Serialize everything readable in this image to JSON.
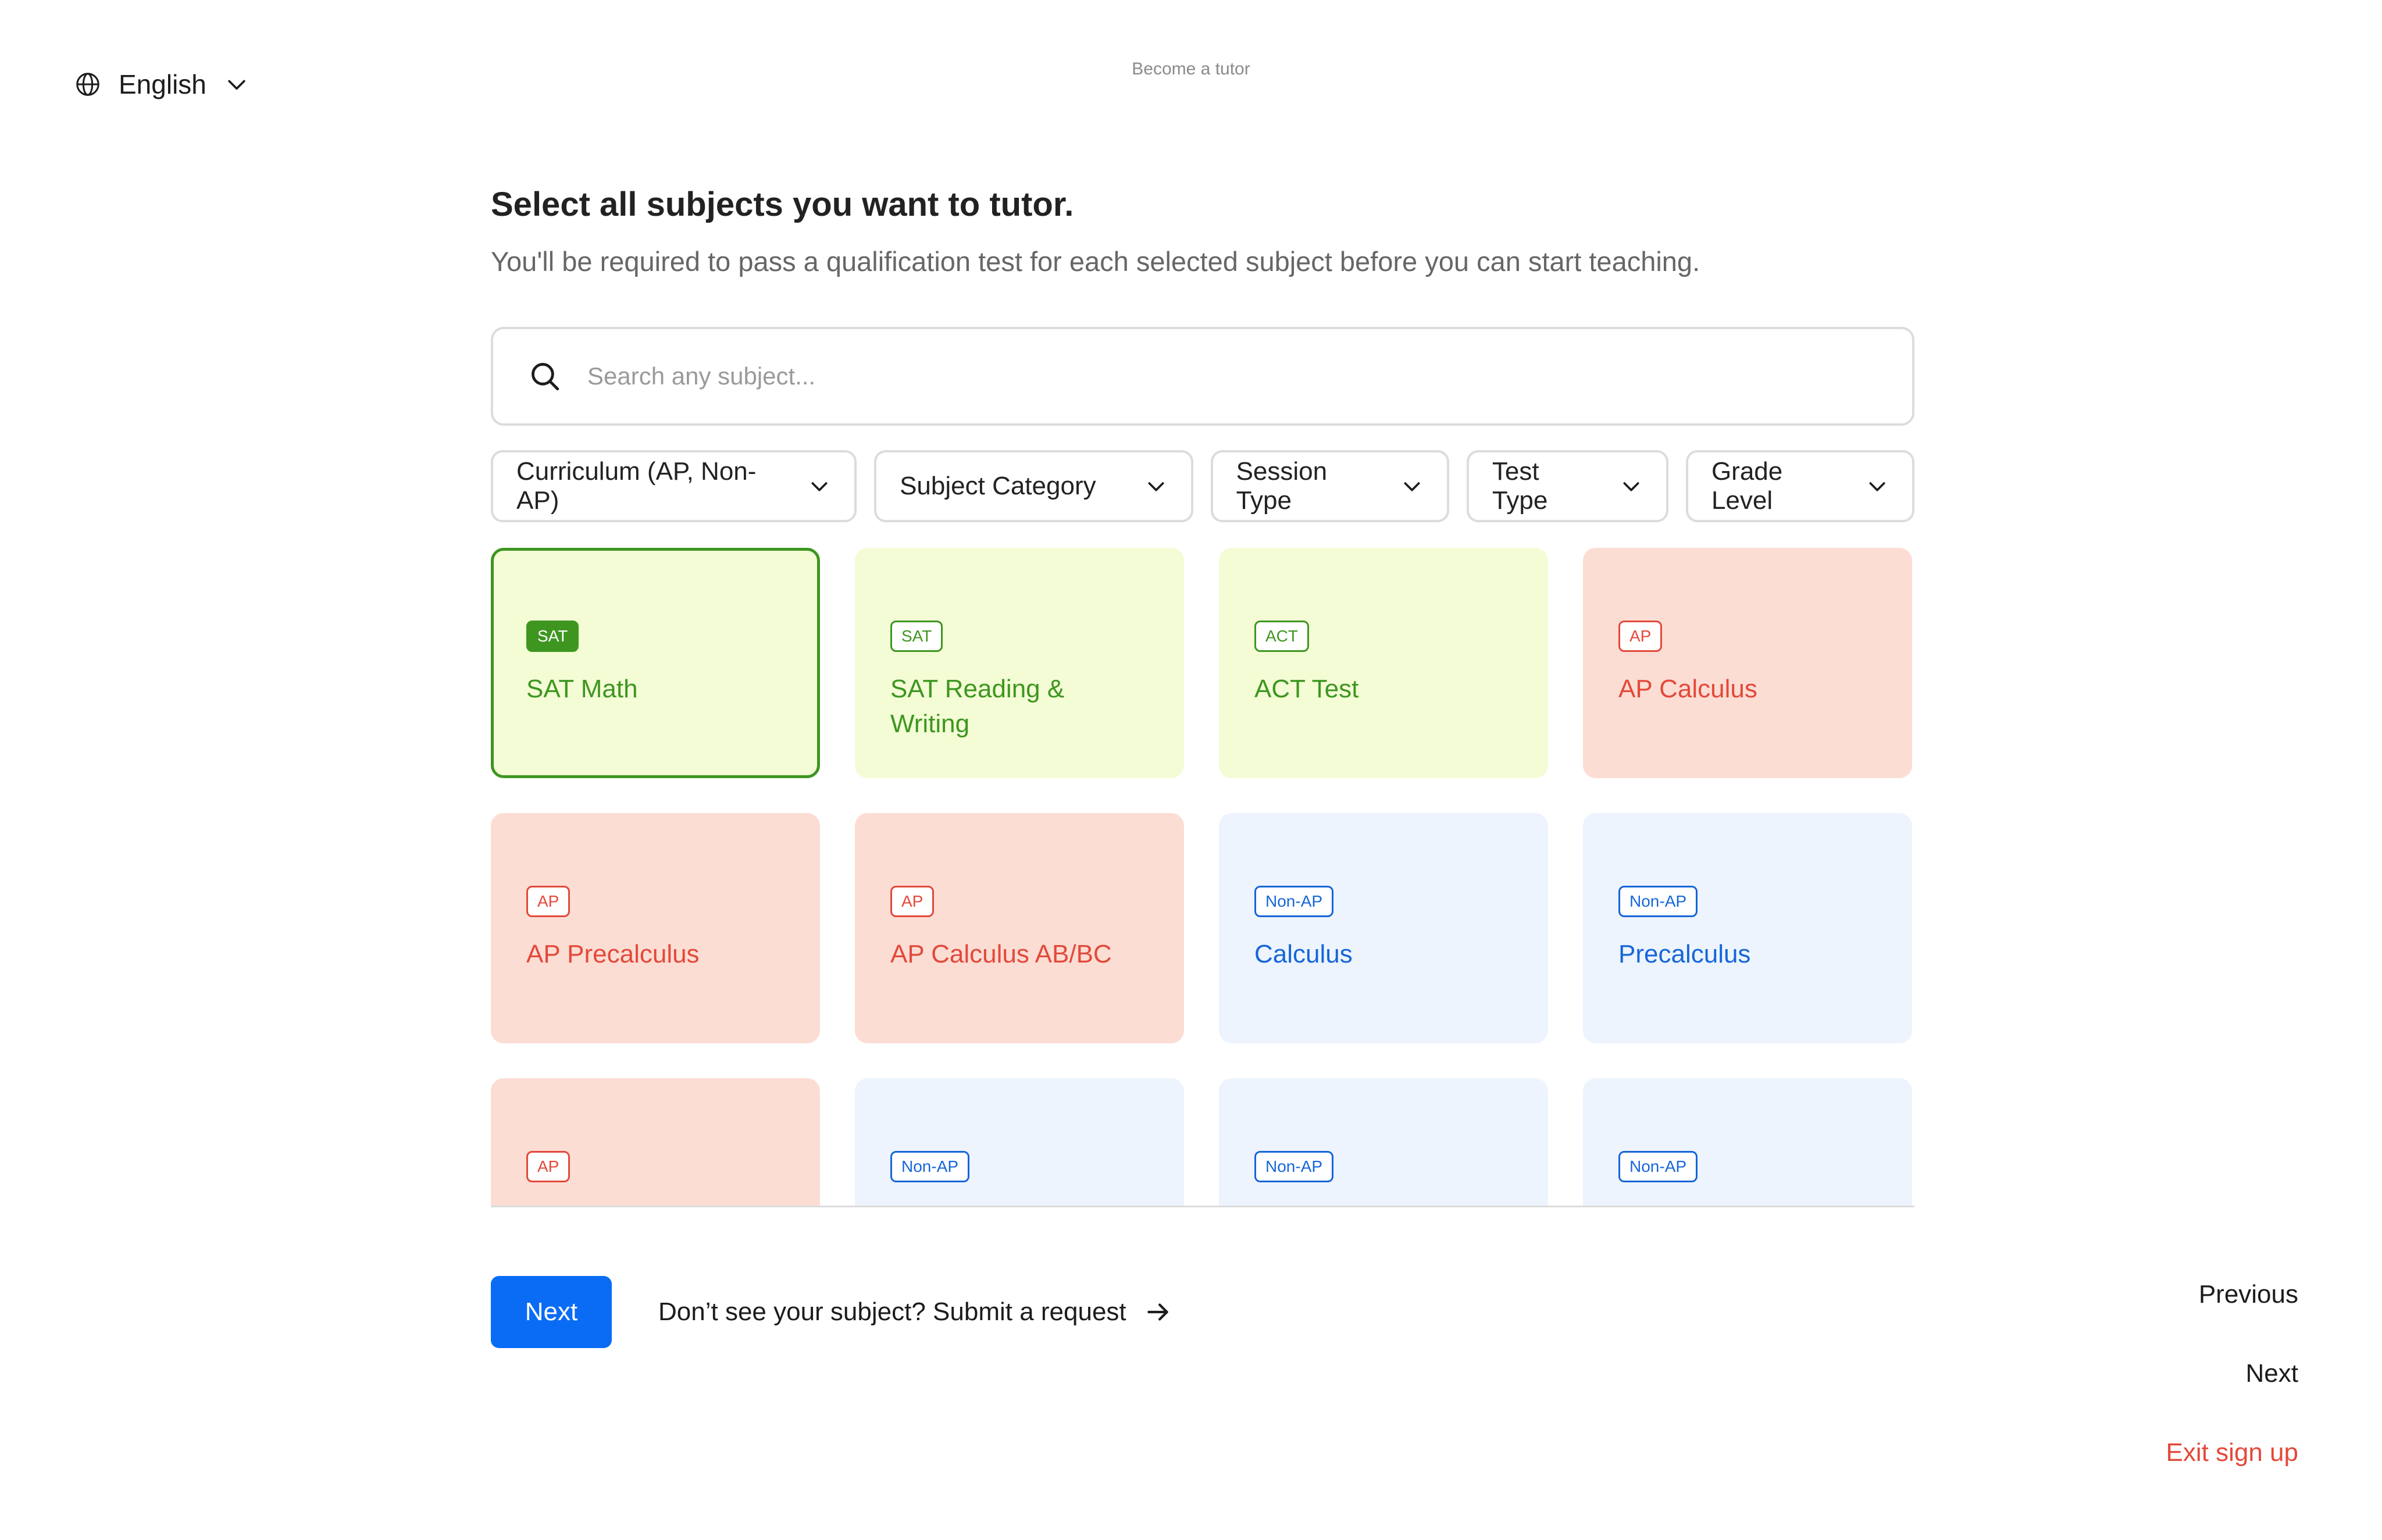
{
  "language": {
    "label": "English",
    "icon": "globe-icon"
  },
  "header": {
    "title": "Become a tutor"
  },
  "heading": "Select all subjects you want to tutor.",
  "subheading": "You'll be required to pass a qualification test for each selected subject before you can start teaching.",
  "search": {
    "placeholder": "Search any subject...",
    "value": ""
  },
  "filters": [
    {
      "label": "Curriculum (AP, Non-AP)"
    },
    {
      "label": "Subject Category"
    },
    {
      "label": "Session Type"
    },
    {
      "label": "Test Type"
    },
    {
      "label": "Grade Level"
    }
  ],
  "cards": [
    {
      "badge": "SAT",
      "title": "SAT Math",
      "color": "green",
      "selected": true
    },
    {
      "badge": "SAT",
      "title": "SAT Reading & Writing",
      "color": "green",
      "selected": false
    },
    {
      "badge": "ACT",
      "title": "ACT Test",
      "color": "green",
      "selected": false
    },
    {
      "badge": "AP",
      "title": "AP Calculus",
      "color": "red",
      "selected": false
    },
    {
      "badge": "AP",
      "title": "AP Precalculus",
      "color": "red",
      "selected": false
    },
    {
      "badge": "AP",
      "title": "AP Calculus AB/BC",
      "color": "red",
      "selected": false
    },
    {
      "badge": "Non-AP",
      "title": "Calculus",
      "color": "blue",
      "selected": false
    },
    {
      "badge": "Non-AP",
      "title": "Precalculus",
      "color": "blue",
      "selected": false
    },
    {
      "badge": "AP",
      "title": "",
      "color": "red",
      "selected": false
    },
    {
      "badge": "Non-AP",
      "title": "",
      "color": "blue",
      "selected": false
    },
    {
      "badge": "Non-AP",
      "title": "",
      "color": "blue",
      "selected": false
    },
    {
      "badge": "Non-AP",
      "title": "",
      "color": "blue",
      "selected": false
    }
  ],
  "actions": {
    "next_label": "Next",
    "request_label": "Don’t see your subject? Submit a request"
  },
  "nav": {
    "previous": "Previous",
    "next": "Next",
    "exit": "Exit sign up"
  },
  "colors": {
    "accent": "#0a6cf5",
    "sat_green": "#3e9620",
    "ap_red": "#e3493a",
    "nonap_blue": "#1666d8"
  }
}
